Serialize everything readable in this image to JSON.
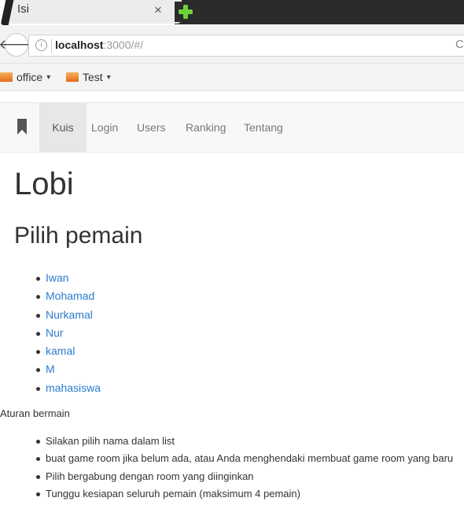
{
  "browser": {
    "tab_title": "Isi",
    "tab_close": "×",
    "back_glyph": "🡐",
    "url_host": "localhost",
    "url_rest": ":3000/#/",
    "reload_glyph": "C"
  },
  "bookmarks": [
    {
      "label": "office"
    },
    {
      "label": "Test"
    }
  ],
  "nav": {
    "items": [
      {
        "label": "Kuis",
        "active": true
      },
      {
        "label": "Login"
      },
      {
        "label": "Users"
      },
      {
        "label": "Ranking"
      },
      {
        "label": "Tentang"
      }
    ]
  },
  "page": {
    "title": "Lobi",
    "subtitle": "Pilih pemain",
    "players": [
      "Iwan",
      "Mohamad",
      "Nurkamal",
      "Nur",
      "kamal",
      "M",
      "mahasiswa"
    ],
    "rules_title": "Aturan bermain",
    "rules": [
      "Silakan pilih nama dalam list",
      "buat game room jika belum ada, atau Anda menghendaki membuat game room yang baru",
      "Pilih bergabung dengan room yang diinginkan",
      "Tunggu kesiapan seluruh pemain (maksimum 4 pemain)"
    ]
  },
  "colors": {
    "link": "#2a7ccf",
    "newtab_plus": "#6fd23a"
  }
}
